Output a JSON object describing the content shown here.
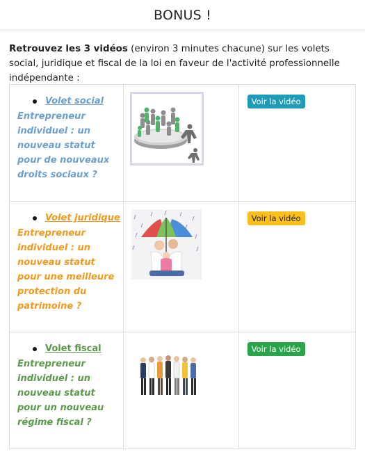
{
  "header": {
    "title": "BONUS !"
  },
  "intro": {
    "bold": "Retrouvez les 3 vidéos",
    "rest": " (environ 3 minutes chacune) sur les volets social, juridique et fiscal de la loi en faveur de l'activité professionnelle indépendante :"
  },
  "videos": [
    {
      "title": "Volet social",
      "description": "Entrepreneur individuel : un nouveau statut pour de nouveaux droits sociaux ?",
      "image_icon": "people-network-icon",
      "button_label": "Voir la vidéo",
      "color": "#6a9fcf",
      "button_color": "#1e9bb6"
    },
    {
      "title": "Volet juridique",
      "description": "Entrepreneur individuel : un nouveau statut pour une meilleure protection du patrimoine ?",
      "image_icon": "family-umbrella-icon",
      "button_label": "Voir la vidéo",
      "color": "#f39a1e",
      "button_color": "#fbbf1c"
    },
    {
      "title": "Volet fiscal",
      "description": "Entrepreneur individuel : un nouveau statut pour un nouveau régime fiscal ?",
      "image_icon": "workers-group-icon",
      "button_label": "Voir la vidéo",
      "color": "#5b9a4b",
      "button_color": "#2aa44a"
    }
  ]
}
